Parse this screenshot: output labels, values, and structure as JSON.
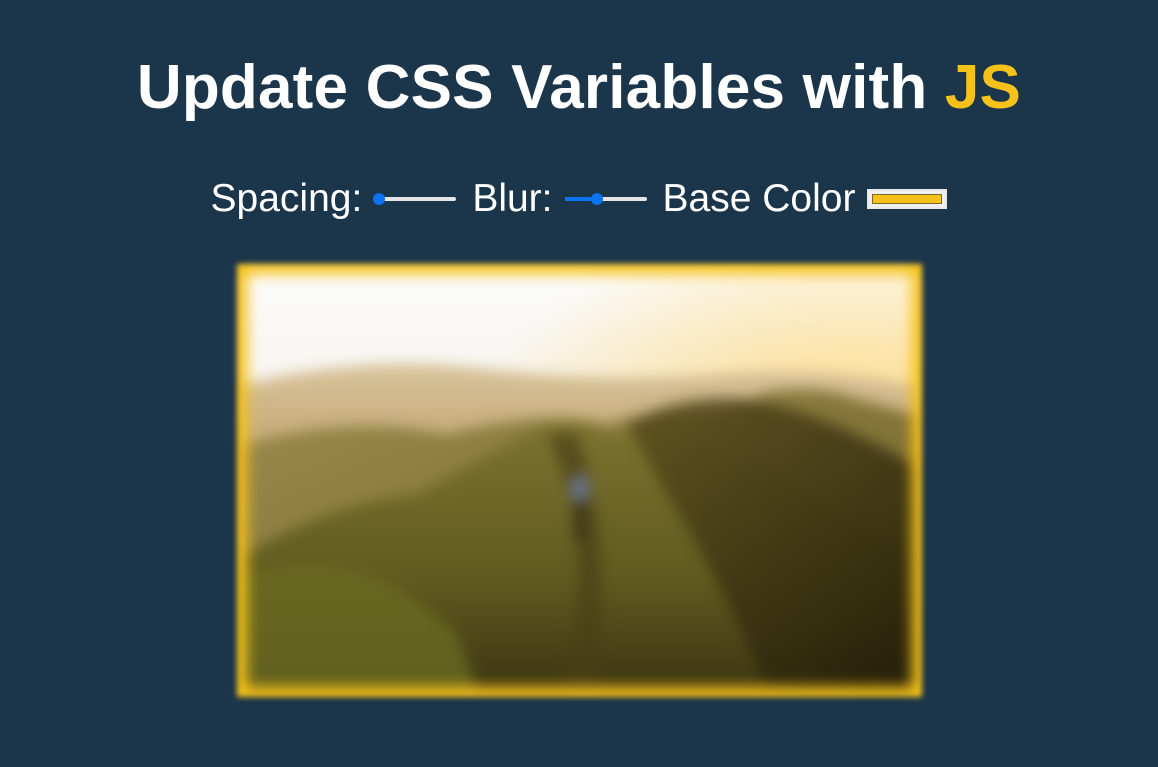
{
  "heading": {
    "text": "Update CSS Variables with",
    "highlight": "JS",
    "highlight_color": "#f6c21a"
  },
  "controls": {
    "spacing": {
      "label": "Spacing:",
      "value": 0.06
    },
    "blur": {
      "label": "Blur:",
      "value": 0.4
    },
    "base_color": {
      "label": "Base Color",
      "value": "#f6c21a"
    }
  },
  "image": {
    "name": "mountain-ridge-photo",
    "frame_color": "#f6c21a"
  },
  "colors": {
    "background": "#1b354b",
    "text": "#ffffff",
    "slider_accent": "#0a74f0"
  }
}
